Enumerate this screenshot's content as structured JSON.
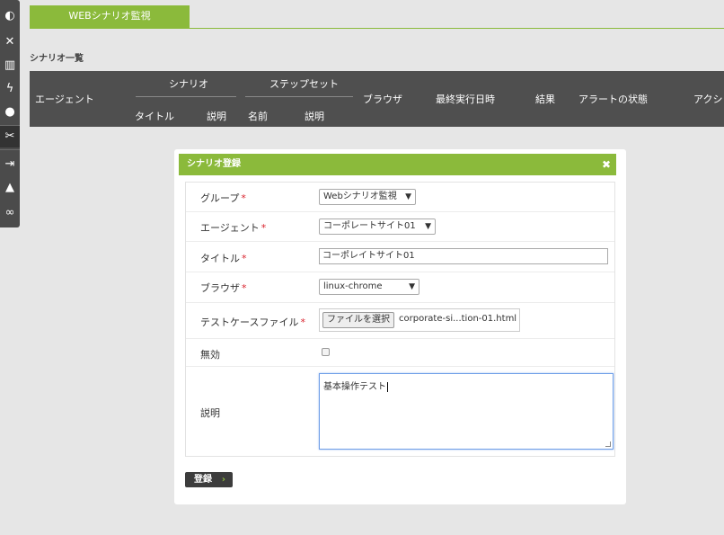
{
  "rail": {
    "icons": [
      "dashboard-icon",
      "monitor-icon",
      "report-icon",
      "lightning-icon",
      "user-icon",
      "tools-icon",
      "login-icon",
      "bell-icon",
      "link-icon"
    ],
    "glyphs": [
      "◐",
      "✕",
      "▥",
      "ϟ",
      "●",
      "✂",
      "⇥",
      "▲",
      "∞"
    ]
  },
  "tab": {
    "label": "WEBシナリオ監視"
  },
  "section_title": "シナリオ一覧",
  "table_header": {
    "agent": "エージェント",
    "scenario_group": "シナリオ",
    "stepset_group": "ステップセット",
    "title": "タイトル",
    "description": "説明",
    "name": "名前",
    "description2": "説明",
    "browser": "ブラウザ",
    "last_run": "最終実行日時",
    "result": "結果",
    "alert_state": "アラートの状態",
    "action": "アクション"
  },
  "modal": {
    "title": "シナリオ登録",
    "close": "✖",
    "fields": {
      "group": {
        "label": "グループ",
        "required": "*",
        "value": "Webシナリオ監視"
      },
      "agent": {
        "label": "エージェント",
        "required": "*",
        "value": "コーポレートサイト01"
      },
      "title": {
        "label": "タイトル",
        "required": "*",
        "value": "コーポレイトサイト01"
      },
      "browser": {
        "label": "ブラウザ",
        "required": "*",
        "value": "linux-chrome"
      },
      "testcase": {
        "label": "テストケースファイル",
        "required": "*",
        "button": "ファイルを選択",
        "filename": "corporate-si...tion-01.html"
      },
      "disabled": {
        "label": "無効",
        "checked": false
      },
      "description": {
        "label": "説明",
        "value": "基本操作テスト"
      }
    },
    "submit": {
      "label": "登録",
      "chevron": "›"
    }
  },
  "colors": {
    "accent": "#8bba3b",
    "header_bg": "#4f4f4f",
    "rail_bg": "#4b4b4b",
    "required": "#d9232d"
  }
}
